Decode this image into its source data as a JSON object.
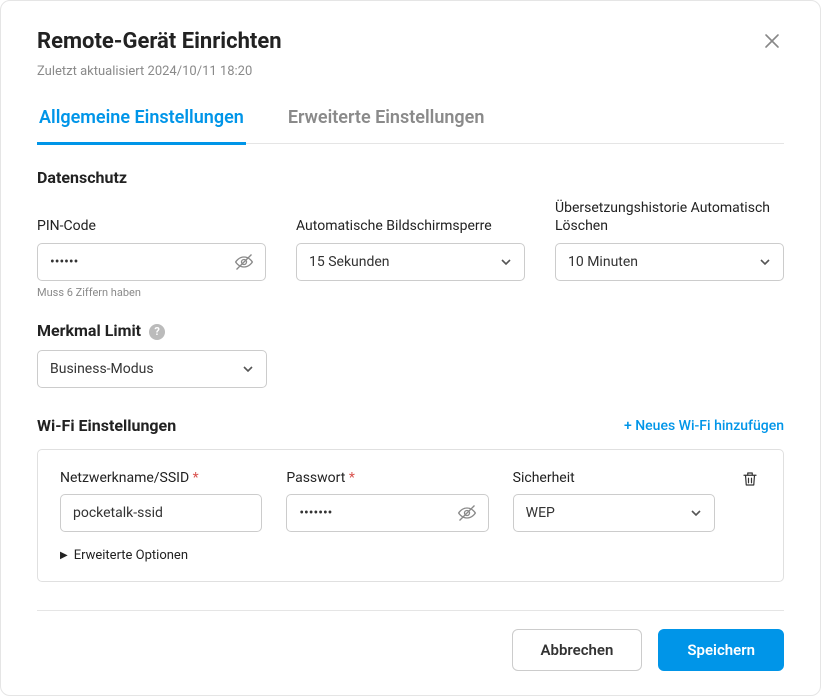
{
  "header": {
    "title": "Remote-Gerät Einrichten",
    "subtitle": "Zuletzt aktualisiert 2024/10/11 18:20"
  },
  "tabs": {
    "general": "Allgemeine Einstellungen",
    "advanced": "Erweiterte Einstellungen"
  },
  "privacy": {
    "section": "Datenschutz",
    "pin_label": "PIN-Code",
    "pin_value": "••••••",
    "pin_hint": "Muss 6 Ziffern haben",
    "screenlock_label": "Automatische Bildschirmsperre",
    "screenlock_value": "15 Sekunden",
    "autodelete_label": "Übersetzungshistorie Automatisch Löschen",
    "autodelete_value": "10 Minuten"
  },
  "feature": {
    "label": "Merkmal Limit",
    "value": "Business-Modus"
  },
  "wifi": {
    "section": "Wi-Fi Einstellungen",
    "add_label": "+ Neues Wi-Fi hinzufügen",
    "ssid_label": "Netzwerkname/SSID",
    "ssid_value": "pocketalk-ssid",
    "password_label": "Passwort",
    "password_value": "•••••••",
    "security_label": "Sicherheit",
    "security_value": "WEP",
    "advanced_label": "Erweiterte Optionen"
  },
  "footer": {
    "cancel": "Abbrechen",
    "save": "Speichern"
  }
}
